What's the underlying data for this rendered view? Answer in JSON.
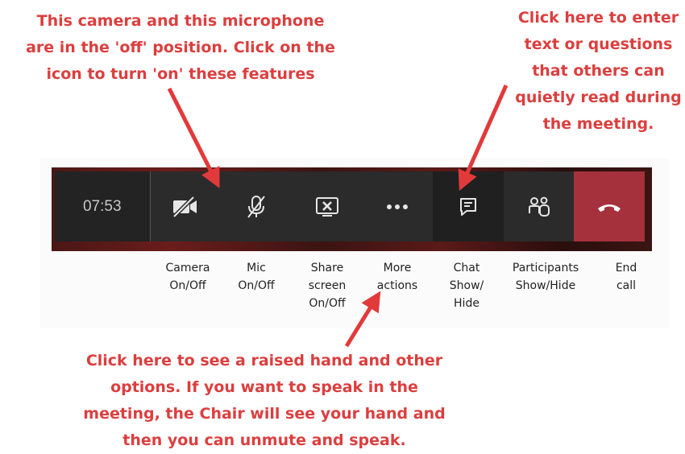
{
  "annotations": {
    "top_left": [
      "This camera and this microphone",
      "are in the 'off' position. Click on the",
      "icon to turn 'on' these features"
    ],
    "top_right": [
      "Click here to enter",
      "text or questions",
      "that others can",
      "quietly read during",
      "the meeting."
    ],
    "bottom": [
      "Click here to see a raised hand and other",
      "options. If you want to speak in the",
      "meeting, the Chair will see your hand and",
      "then you can unmute and speak."
    ]
  },
  "toolbar": {
    "timer": "07:53",
    "buttons": [
      {
        "icon": "camera-off-icon",
        "label": [
          "Camera",
          "On/Off"
        ]
      },
      {
        "icon": "mic-off-icon",
        "label": [
          "Mic",
          "On/Off"
        ]
      },
      {
        "icon": "share-screen-icon",
        "label": [
          "Share",
          "screen",
          "On/Off"
        ]
      },
      {
        "icon": "more-actions-icon",
        "label": [
          "More",
          "actions"
        ]
      },
      {
        "icon": "chat-icon",
        "label": [
          "Chat",
          "Show/",
          "Hide"
        ]
      },
      {
        "icon": "participants-icon",
        "label": [
          "Participants",
          "Show/Hide"
        ]
      },
      {
        "icon": "end-call-icon",
        "label": [
          "End",
          "call"
        ]
      }
    ]
  },
  "colors": {
    "annotation_text": "#dc3e3e",
    "arrow": "#e23a3a",
    "toolbar_bg": "#2b2b2b",
    "end_call_bg": "#a5313c"
  }
}
